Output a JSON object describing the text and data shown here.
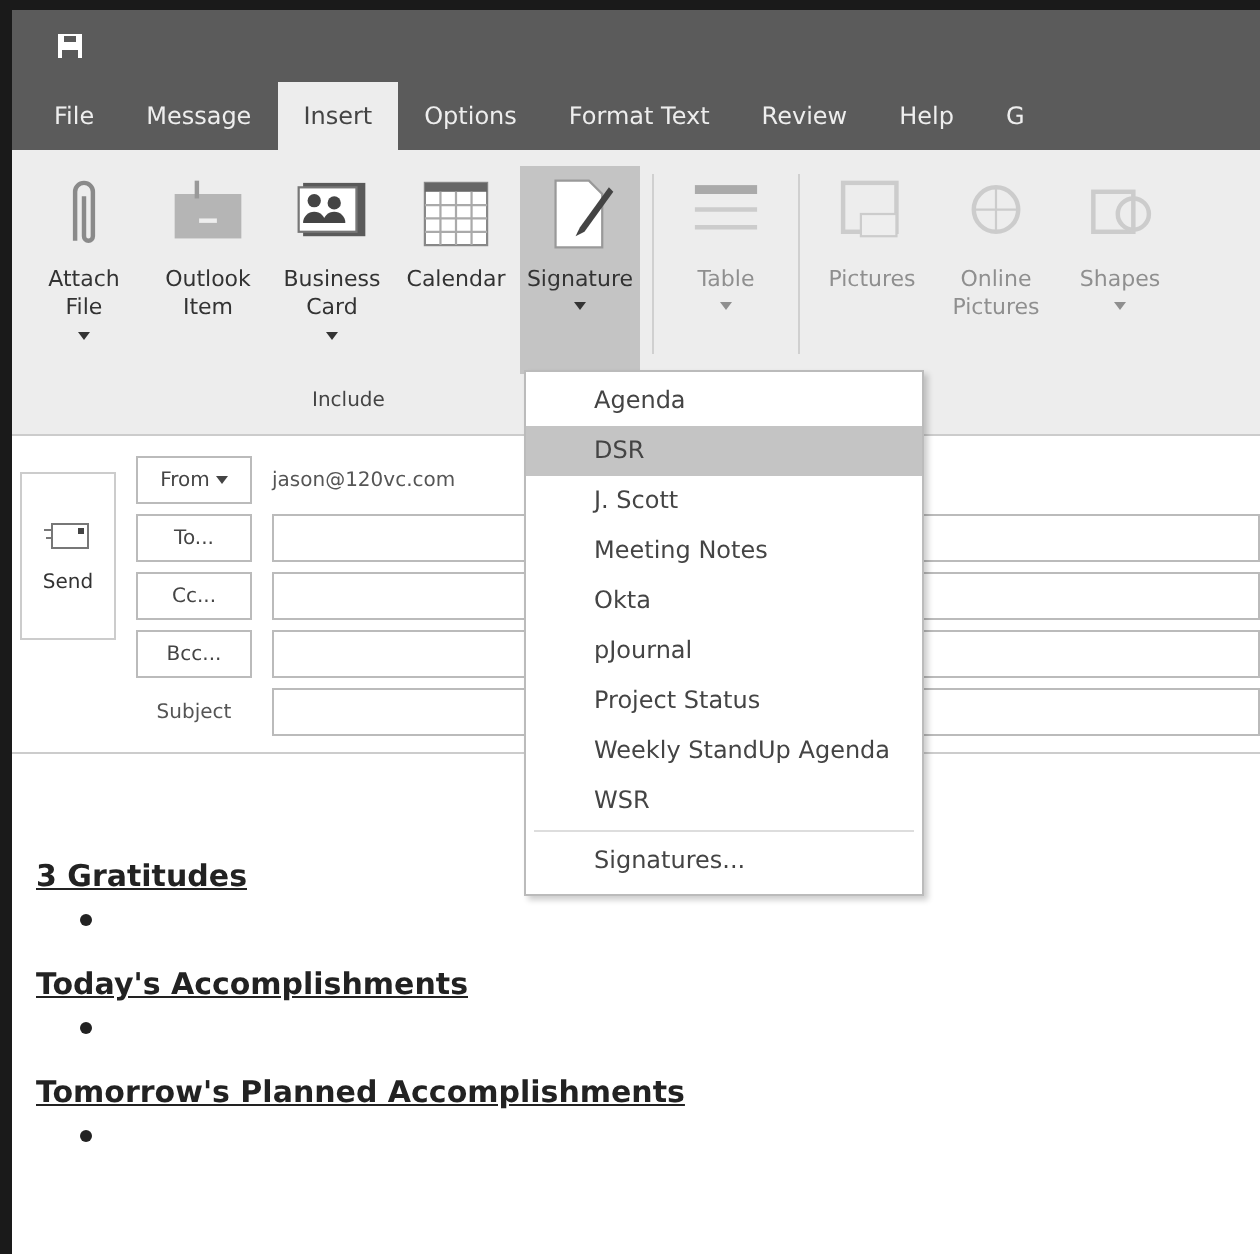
{
  "tabs": [
    {
      "label": "File",
      "selected": false
    },
    {
      "label": "Message",
      "selected": false
    },
    {
      "label": "Insert",
      "selected": true
    },
    {
      "label": "Options",
      "selected": false
    },
    {
      "label": "Format Text",
      "selected": false
    },
    {
      "label": "Review",
      "selected": false
    },
    {
      "label": "Help",
      "selected": false
    },
    {
      "label": "G",
      "selected": false
    }
  ],
  "ribbon": {
    "buttons": [
      {
        "label": "Attach File",
        "caret": true,
        "disabled": false,
        "pressed": false,
        "kind": "clip"
      },
      {
        "label": "Outlook Item",
        "caret": false,
        "disabled": false,
        "pressed": false,
        "kind": "envelope"
      },
      {
        "label": "Business Card",
        "caret": true,
        "disabled": false,
        "pressed": false,
        "kind": "card"
      },
      {
        "label": "Calendar",
        "caret": false,
        "disabled": false,
        "pressed": false,
        "kind": "calendar"
      },
      {
        "label": "Signature",
        "caret": true,
        "disabled": false,
        "pressed": true,
        "kind": "signature"
      },
      {
        "label": "Table",
        "caret": true,
        "disabled": true,
        "pressed": false,
        "kind": "table"
      },
      {
        "label": "Pictures",
        "caret": false,
        "disabled": true,
        "pressed": false,
        "kind": "pictures"
      },
      {
        "label": "Online Pictures",
        "caret": false,
        "disabled": true,
        "pressed": false,
        "kind": "online"
      },
      {
        "label": "Shapes",
        "caret": true,
        "disabled": true,
        "pressed": false,
        "kind": "shapes"
      }
    ],
    "group_label": "Include"
  },
  "signature_menu": {
    "items": [
      {
        "label": "Agenda",
        "selected": false
      },
      {
        "label": "DSR",
        "selected": true
      },
      {
        "label": "J. Scott",
        "selected": false
      },
      {
        "label": "Meeting Notes",
        "selected": false
      },
      {
        "label": "Okta",
        "selected": false
      },
      {
        "label": "pJournal",
        "selected": false
      },
      {
        "label": "Project Status",
        "selected": false
      },
      {
        "label": "Weekly StandUp Agenda",
        "selected": false
      },
      {
        "label": "WSR",
        "selected": false
      }
    ],
    "footer": "Signatures..."
  },
  "compose": {
    "send": "Send",
    "from_button": "From",
    "from_value": "jason@120vc.com",
    "fields": [
      {
        "label": "To..."
      },
      {
        "label": "Cc..."
      },
      {
        "label": "Bcc..."
      }
    ],
    "subject_label": "Subject"
  },
  "body": [
    {
      "heading": "3 Gratitudes"
    },
    {
      "heading": "Today's Accomplishments"
    },
    {
      "heading": "Tomorrow's Planned Accomplishments"
    }
  ]
}
